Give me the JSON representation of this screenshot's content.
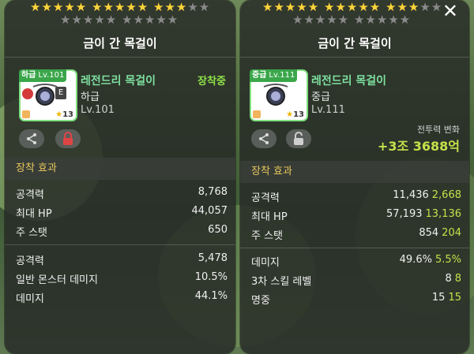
{
  "colors": {
    "accent_green": "#7ee0a0",
    "stat_bonus": "#c6e04a",
    "section_gold": "#e8c85a",
    "equipped_green": "#8fe04a",
    "lock_red": "#d43a3a"
  },
  "left": {
    "stars_row1": "★★★★★ ★★★★★ ★★★",
    "stars_row1_off": "★★",
    "stars_row2_off": "★★★★★ ★★★★★",
    "title": "금이 간 목걸이",
    "grade_tag": "하급",
    "level_tag": "Lv.101",
    "star_count": "13",
    "item_name": "레전드리 목걸이",
    "item_grade": "하급",
    "item_level": "Lv.101",
    "equipped": "장착중",
    "section": "장착 효과",
    "stats": [
      {
        "label": "공격력",
        "value": "8,768"
      },
      {
        "label": "최대 HP",
        "value": "44,057"
      },
      {
        "label": "주 스탯",
        "value": "650"
      }
    ],
    "stats2": [
      {
        "label": "공격력",
        "value": "5,478"
      },
      {
        "label": "일반 몬스터 데미지",
        "value": "10.5%"
      },
      {
        "label": "데미지",
        "value": "44.1%"
      }
    ]
  },
  "right": {
    "stars_row1": "★★★★★ ★★★★★ ★★★",
    "stars_row1_off": "★★",
    "stars_row2_off": "★★★★★ ★★★★★",
    "title": "금이 간 목걸이",
    "close": "✕",
    "grade_tag": "중급",
    "level_tag": "Lv.111",
    "star_count": "13",
    "item_name": "레전드리 목걸이",
    "item_grade": "중급",
    "item_level": "Lv.111",
    "power_label": "전투력 변화",
    "power_value": "+3조 3688억",
    "section": "장착 효과",
    "stats": [
      {
        "label": "공격력",
        "value": "11,436",
        "diff": "2,668"
      },
      {
        "label": "최대 HP",
        "value": "57,193",
        "diff": "13,136"
      },
      {
        "label": "주 스탯",
        "value": "854",
        "diff": "204"
      }
    ],
    "stats2": [
      {
        "label": "데미지",
        "value": "49.6%",
        "diff": "5.5%"
      },
      {
        "label": "3차 스킬 레벨",
        "value": "8",
        "diff": "8"
      },
      {
        "label": "명중",
        "value": "15",
        "diff": "15"
      }
    ]
  }
}
